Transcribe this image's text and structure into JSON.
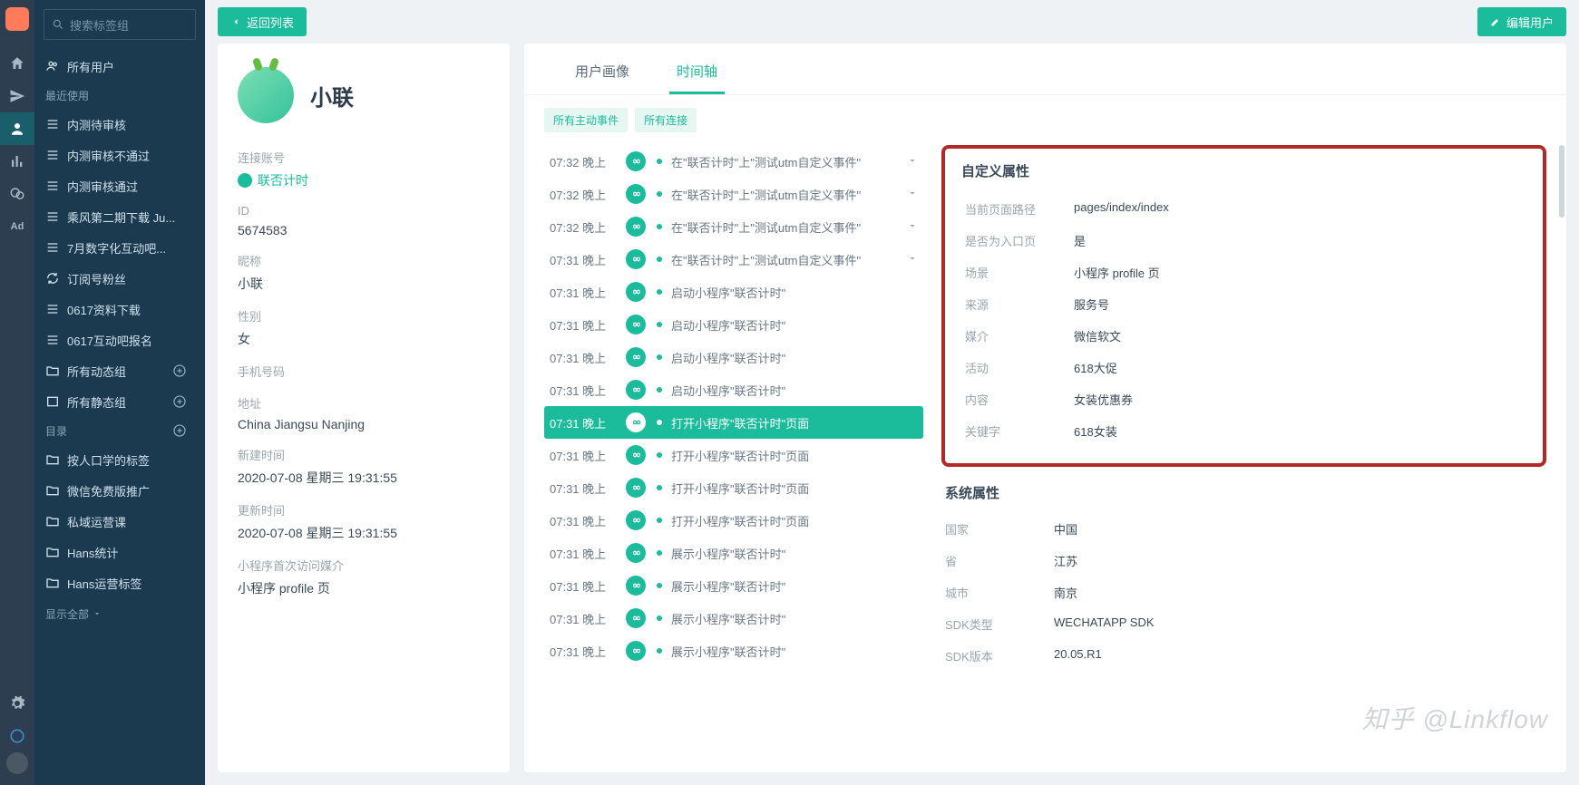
{
  "search_placeholder": "搜索标签组",
  "sidebar": {
    "all_users": "所有用户",
    "recent": "最近使用",
    "recent_items": [
      "内测待审核",
      "内测审核不通过",
      "内测审核通过",
      "乘风第二期下载 Ju...",
      "7月数字化互动吧...",
      "订阅号粉丝",
      "0617资料下载",
      "0617互动吧报名"
    ],
    "dynamic_groups": "所有动态组",
    "static_groups": "所有静态组",
    "catalog": "目录",
    "catalog_items": [
      "按人口学的标签",
      "微信免费版推广",
      "私域运营课",
      "Hans统计",
      "Hans运营标签"
    ],
    "show_all": "显示全部"
  },
  "topbar": {
    "back": "返回列表",
    "edit": "编辑用户"
  },
  "profile": {
    "name": "小联",
    "labels": {
      "account": "连接账号",
      "id": "ID",
      "nick": "昵称",
      "gender": "性别",
      "phone": "手机号码",
      "address": "地址",
      "created": "新建时间",
      "updated": "更新时间",
      "first_media": "小程序首次访问媒介"
    },
    "account": "联否计时",
    "id": "5674583",
    "nick": "小联",
    "gender": "女",
    "phone": "",
    "address": "China Jiangsu Nanjing",
    "created": "2020-07-08 星期三 19:31:55",
    "updated": "2020-07-08 星期三 19:31:55",
    "first_media": "小程序 profile 页"
  },
  "tabs": {
    "portrait": "用户画像",
    "timeline": "时间轴"
  },
  "filters": {
    "active": "所有主动事件",
    "conn": "所有连接"
  },
  "events": [
    {
      "time": "07:32 晚上",
      "desc": "在\"联否计时\"上\"测试utm自定义事件\"",
      "expandable": true
    },
    {
      "time": "07:32 晚上",
      "desc": "在\"联否计时\"上\"测试utm自定义事件\"",
      "expandable": true
    },
    {
      "time": "07:32 晚上",
      "desc": "在\"联否计时\"上\"测试utm自定义事件\"",
      "expandable": true
    },
    {
      "time": "07:31 晚上",
      "desc": "在\"联否计时\"上\"测试utm自定义事件\"",
      "expandable": true
    },
    {
      "time": "07:31 晚上",
      "desc": "启动小程序\"联否计时\""
    },
    {
      "time": "07:31 晚上",
      "desc": "启动小程序\"联否计时\""
    },
    {
      "time": "07:31 晚上",
      "desc": "启动小程序\"联否计时\""
    },
    {
      "time": "07:31 晚上",
      "desc": "启动小程序\"联否计时\""
    },
    {
      "time": "07:31 晚上",
      "desc": "打开小程序\"联否计时\"页面",
      "selected": true
    },
    {
      "time": "07:31 晚上",
      "desc": "打开小程序\"联否计时\"页面"
    },
    {
      "time": "07:31 晚上",
      "desc": "打开小程序\"联否计时\"页面"
    },
    {
      "time": "07:31 晚上",
      "desc": "打开小程序\"联否计时\"页面"
    },
    {
      "time": "07:31 晚上",
      "desc": "展示小程序\"联否计时\""
    },
    {
      "time": "07:31 晚上",
      "desc": "展示小程序\"联否计时\""
    },
    {
      "time": "07:31 晚上",
      "desc": "展示小程序\"联否计时\""
    },
    {
      "time": "07:31 晚上",
      "desc": "展示小程序\"联否计时\""
    }
  ],
  "detail": {
    "custom_h": "自定义属性",
    "custom": [
      {
        "k": "当前页面路径",
        "v": "pages/index/index"
      },
      {
        "k": "是否为入口页",
        "v": "是"
      },
      {
        "k": "场景",
        "v": "小程序 profile 页"
      },
      {
        "k": "来源",
        "v": "服务号"
      },
      {
        "k": "媒介",
        "v": "微信软文"
      },
      {
        "k": "活动",
        "v": "618大促"
      },
      {
        "k": "内容",
        "v": "女装优惠券"
      },
      {
        "k": "关键字",
        "v": "618女装"
      }
    ],
    "system_h": "系统属性",
    "system": [
      {
        "k": "国家",
        "v": "中国"
      },
      {
        "k": "省",
        "v": "江苏"
      },
      {
        "k": "城市",
        "v": "南京"
      },
      {
        "k": "SDK类型",
        "v": "WECHATAPP SDK"
      },
      {
        "k": "SDK版本",
        "v": "20.05.R1"
      }
    ]
  },
  "watermark": "知乎 @Linkflow"
}
